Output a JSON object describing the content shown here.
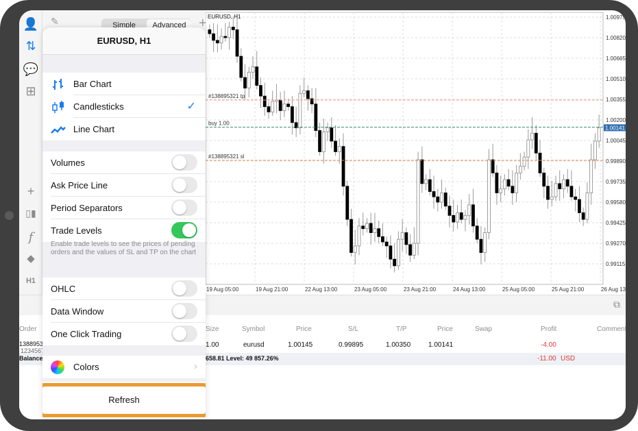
{
  "toolbar": {
    "simple_label": "Simple",
    "advanced_label": "Advanced",
    "timeframe_label": "H1"
  },
  "chart": {
    "symbol_label": "EURUSD, H1",
    "price_ticks": [
      "1.00975",
      "1.00820",
      "1.00665",
      "1.00510",
      "1.00355",
      "1.00200",
      "1.00045",
      "0.99890",
      "0.99735",
      "0.99580",
      "0.99425",
      "0.99270",
      "0.99115"
    ],
    "current_price": "1.00141",
    "time_ticks": [
      "19 Aug 05:00",
      "19 Aug 21:00",
      "22 Aug 13:00",
      "23 Aug 05:00",
      "23 Aug 21:00",
      "24 Aug 13:00",
      "25 Aug 05:00",
      "25 Aug 21:00",
      "26 Aug 13:00"
    ],
    "trade_levels": [
      {
        "label": "#138895321 tp",
        "price": 1.0035,
        "color": "#f4a37f"
      },
      {
        "label": "buy 1.00",
        "price": 1.00145,
        "color": "#3d8a6a"
      },
      {
        "label": "#138895321 sl",
        "price": 0.99895,
        "color": "#f08a5a"
      }
    ],
    "closes": [
      1.0085,
      1.008,
      1.0078,
      1.0083,
      1.0082,
      1.009,
      1.0088,
      1.0068,
      1.0052,
      1.0044,
      1.0056,
      1.006,
      1.0046,
      1.0038,
      1.003,
      1.0026,
      1.0034,
      1.0035,
      1.0027,
      1.0032,
      1.003,
      1.0018,
      1.0014,
      1.004,
      1.0042,
      1.0036,
      1.0032,
      1.0012,
      0.9996,
      1.0011,
      1.0014,
      1.0004,
      0.9996,
      1.0,
      0.997,
      0.9945,
      0.992,
      0.9925,
      0.994,
      0.9938,
      0.9942,
      0.9935,
      0.9938,
      0.9932,
      0.9928,
      0.9925,
      0.9915,
      0.991,
      0.993,
      0.9935,
      0.9926,
      0.9918,
      0.9927,
      0.999,
      0.9972,
      0.9975,
      0.9966,
      0.9962,
      0.9958,
      0.9965,
      0.9955,
      0.9948,
      0.9943,
      0.995,
      0.9945,
      0.9948,
      0.9956,
      0.994,
      0.993,
      0.992,
      0.9935,
      0.999,
      0.998,
      0.9965,
      0.9968,
      0.9975,
      0.997,
      0.9965,
      0.998,
      0.9985,
      0.9992,
      1.0005,
      1.001,
      0.9995,
      0.998,
      0.997,
      0.996,
      0.9962,
      0.9972,
      0.9968,
      0.9975,
      0.997,
      0.9962,
      0.996,
      0.995,
      0.9945,
      0.9965,
      0.999,
      1.0004,
      1.0014
    ]
  },
  "popover": {
    "title": "EURUSD, H1",
    "chart_types": [
      {
        "label": "Bar Chart",
        "icon": "bar-chart-icon",
        "selected": false
      },
      {
        "label": "Candlesticks",
        "icon": "candlesticks-icon",
        "selected": true
      },
      {
        "label": "Line Chart",
        "icon": "line-chart-icon",
        "selected": false
      }
    ],
    "check_mark": "✓",
    "toggles1": [
      {
        "label": "Volumes",
        "on": false
      },
      {
        "label": "Ask Price Line",
        "on": false
      },
      {
        "label": "Period Separators",
        "on": false
      },
      {
        "label": "Trade Levels",
        "on": true
      }
    ],
    "note": "Enable trade levels to see the prices of pending orders and the values of SL and TP on the chart",
    "toggles2": [
      {
        "label": "OHLC",
        "on": false
      },
      {
        "label": "Data Window",
        "on": false
      },
      {
        "label": "One Click Trading",
        "on": false
      }
    ],
    "colors_label": "Colors",
    "refresh_label": "Refresh",
    "accent": "#1a7cf0",
    "toggle_on_color": "#34c759",
    "highlight_color": "#ea9a2f"
  },
  "table": {
    "headers": {
      "order": "Order",
      "size": "Size",
      "symbol": "Symbol",
      "price": "Price",
      "sl": "S/L",
      "tp": "T/P",
      "price2": "Price",
      "swap": "Swap",
      "profit": "Profit",
      "comment": "Comment"
    },
    "row": {
      "order": "1388953",
      "order2": "1234567",
      "size": "1.00",
      "symbol": "eurusd",
      "price": "1.00145",
      "sl": "0.99895",
      "tp": "1.00350",
      "price2": "1.00141",
      "profit": "-4.00"
    },
    "balance_label": "Balance",
    "balance_text": "658.81 Level: 49 857.26%",
    "balance_profit": "-11.00",
    "currency": "USD"
  }
}
